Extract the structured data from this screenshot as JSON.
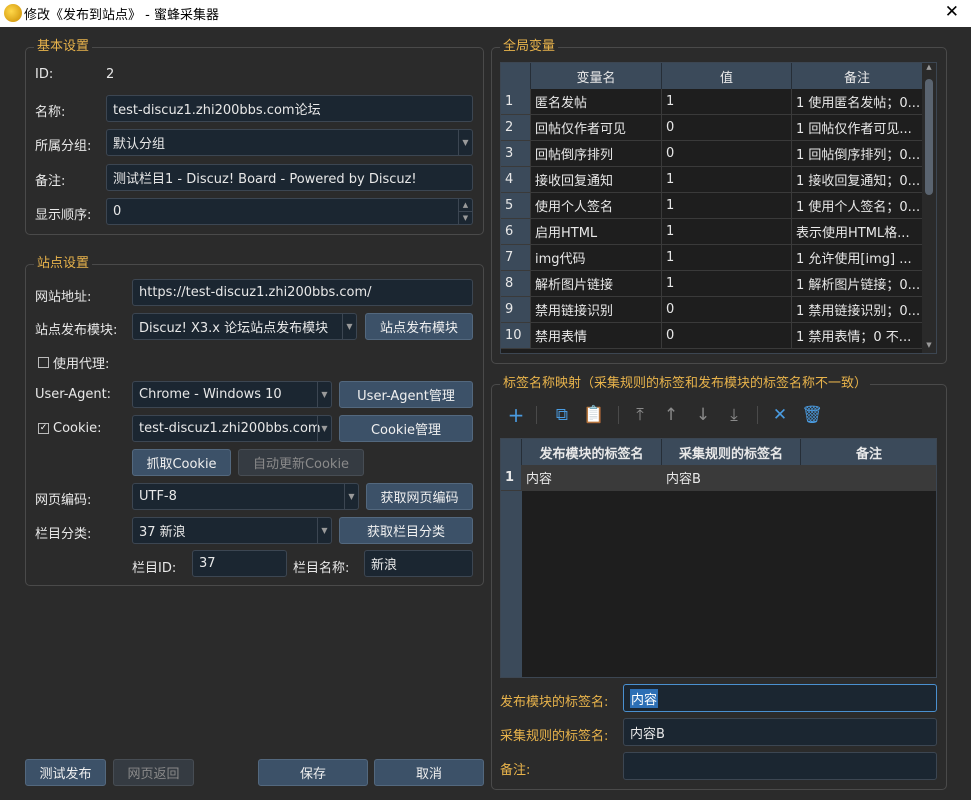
{
  "window": {
    "title": "修改《发布到站点》 - 蜜蜂采集器",
    "close": "✕"
  },
  "basic": {
    "title": "基本设置",
    "id_label": "ID:",
    "id_value": "2",
    "name_label": "名称:",
    "name_value": "test-discuz1.zhi200bbs.com论坛",
    "group_label": "所属分组:",
    "group_value": "默认分组",
    "note_label": "备注:",
    "note_value": "测试栏目1 -  Discuz! Board -  Powered by Discuz!",
    "order_label": "显示顺序:",
    "order_value": "0"
  },
  "site": {
    "title": "站点设置",
    "url_label": "网站地址:",
    "url_value": "https://test-discuz1.zhi200bbs.com/",
    "module_label": "站点发布模块:",
    "module_value": "Discuz! X3.x 论坛站点发布模块",
    "module_button": "站点发布模块",
    "proxy_label": "使用代理:",
    "ua_label": "User-Agent:",
    "ua_value": "Chrome - Windows 10",
    "ua_button": "User-Agent管理",
    "cookie_label": "Cookie:",
    "cookie_value": "test-discuz1.zhi200bbs.com",
    "cookie_button": "Cookie管理",
    "fetch_cookie": "抓取Cookie",
    "auto_cookie": "自动更新Cookie",
    "encoding_label": "网页编码:",
    "encoding_value": "UTF-8",
    "encoding_button": "获取网页编码",
    "category_label": "栏目分类:",
    "category_value": "37 新浪",
    "category_button": "获取栏目分类",
    "catid_label": "栏目ID:",
    "catid_value": "37",
    "catname_label": "栏目名称:",
    "catname_value": "新浪"
  },
  "global_vars": {
    "title": "全局变量",
    "columns": [
      "变量名",
      "值",
      "备注"
    ],
    "rows": [
      [
        "1",
        "匿名发帖",
        "1",
        "1 使用匿名发帖；0..."
      ],
      [
        "2",
        "回帖仅作者可见",
        "0",
        "1 回帖仅作者可见..."
      ],
      [
        "3",
        "回帖倒序排列",
        "0",
        "1 回帖倒序排列；0..."
      ],
      [
        "4",
        "接收回复通知",
        "1",
        "1 接收回复通知；0..."
      ],
      [
        "5",
        "使用个人签名",
        "1",
        "1 使用个人签名；0..."
      ],
      [
        "6",
        "启用HTML",
        "1",
        "表示使用HTML格..."
      ],
      [
        "7",
        "img代码",
        "1",
        "1 允许使用[img] ..."
      ],
      [
        "8",
        "解析图片链接",
        "1",
        "1 解析图片链接；0..."
      ],
      [
        "9",
        "禁用链接识别",
        "0",
        "1 禁用链接识别；0..."
      ],
      [
        "10",
        "禁用表情",
        "0",
        "1 禁用表情；0 不..."
      ]
    ]
  },
  "tag_map": {
    "title": "标签名称映射（采集规则的标签和发布模块的标签名称不一致）",
    "columns": [
      "发布模块的标签名",
      "采集规则的标签名",
      "备注"
    ],
    "rows": [
      [
        "1",
        "内容",
        "内容B",
        ""
      ]
    ],
    "publish_label": "发布模块的标签名:",
    "publish_value": "内容",
    "collect_label": "采集规则的标签名:",
    "collect_value": "内容B",
    "note_label": "备注:",
    "note_value": ""
  },
  "footer": {
    "test": "测试发布",
    "back": "网页返回",
    "save": "保存",
    "cancel": "取消"
  },
  "colors": {
    "accent": "#e8b34b",
    "icon": "#4a9be0"
  }
}
